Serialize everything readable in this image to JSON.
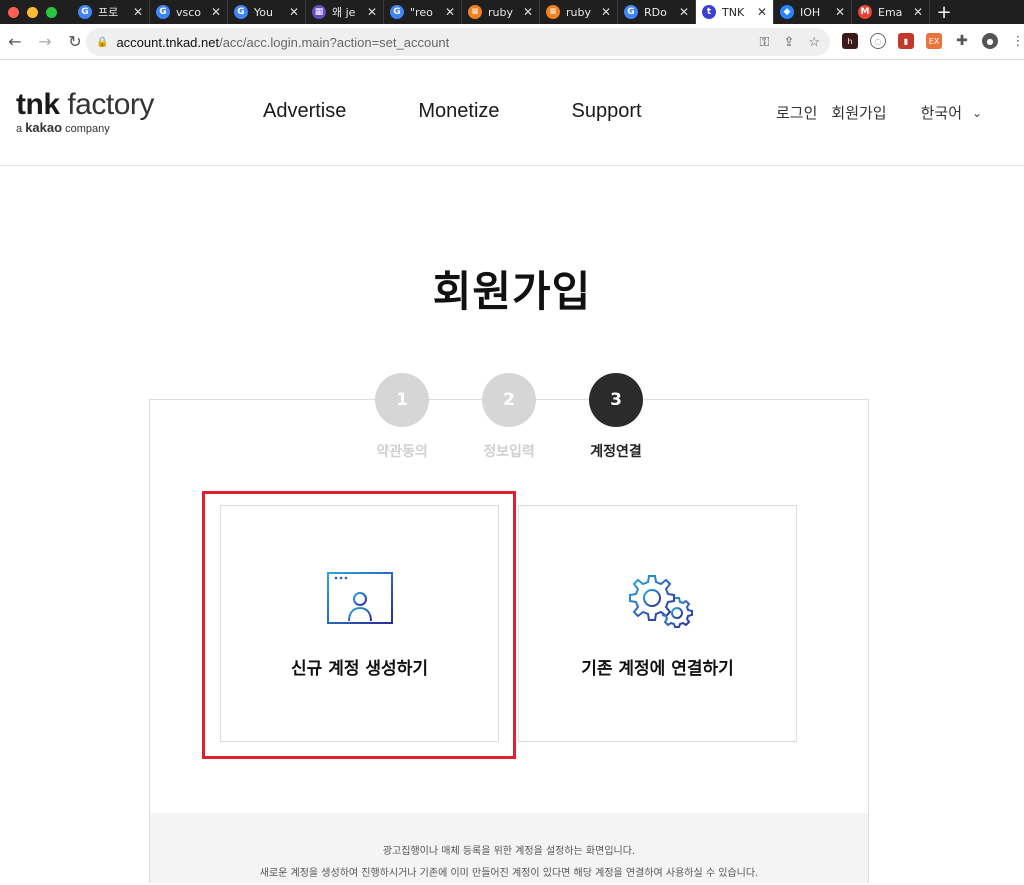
{
  "browser": {
    "tabs": [
      {
        "title": "프로",
        "color": "#4285f4",
        "glyph": "G",
        "active": false
      },
      {
        "title": "vsco",
        "color": "#4285f4",
        "glyph": "G",
        "active": false
      },
      {
        "title": "You",
        "color": "#4285f4",
        "glyph": "G",
        "active": false
      },
      {
        "title": "왜 je",
        "color": "#6a4bc4",
        "glyph": "▦",
        "active": false
      },
      {
        "title": "\"reo",
        "color": "#4285f4",
        "glyph": "G",
        "active": false
      },
      {
        "title": "ruby",
        "color": "#f48024",
        "glyph": "≡",
        "active": false
      },
      {
        "title": "ruby",
        "color": "#f48024",
        "glyph": "≡",
        "active": false
      },
      {
        "title": "RDo",
        "color": "#4285f4",
        "glyph": "G",
        "active": false
      },
      {
        "title": "TNK",
        "color": "#3b3fd8",
        "glyph": "t",
        "active": true
      },
      {
        "title": "IOH",
        "color": "#2684ff",
        "glyph": "◆",
        "active": false
      },
      {
        "title": "Ema",
        "color": "#ea4335",
        "glyph": "M",
        "active": false
      }
    ],
    "new_tab": "+",
    "url_host": "account.tnkad.net",
    "url_path": "/acc/acc.login.main?action=set_account"
  },
  "header": {
    "logo_tnk": "tnk",
    "logo_factory": "factory",
    "logo_sub_a": "a",
    "logo_sub_kakao": "kakao",
    "logo_sub_company": "company",
    "nav": [
      "Advertise",
      "Monetize",
      "Support"
    ],
    "login": "로그인",
    "signup": "회원가입",
    "language": "한국어"
  },
  "page": {
    "title": "회원가입",
    "steps": [
      {
        "number": "1",
        "label": "약관동의",
        "active": false
      },
      {
        "number": "2",
        "label": "정보입력",
        "active": false
      },
      {
        "number": "3",
        "label": "계정연결",
        "active": true
      }
    ],
    "cards": [
      {
        "label": "신규 계정 생성하기",
        "icon": "new-account-window-icon",
        "highlighted": true
      },
      {
        "label": "기존 계정에 연결하기",
        "icon": "gears-icon",
        "highlighted": false
      }
    ],
    "notice_line1": "광고집행이나 매체 등록을 위한 계정을 설정하는 화면입니다.",
    "notice_line2": "새로운 계정을 생성하여 진행하시거나 기존에 이미 만들어진 계정이 있다면 해당 계정을 연결하여 사용하실 수 있습니다."
  },
  "colors": {
    "accent_icon": "#3b4bb8",
    "highlight": "#e0202e",
    "step_active": "#2b2b2b",
    "step_inactive": "#d6d6d6"
  }
}
